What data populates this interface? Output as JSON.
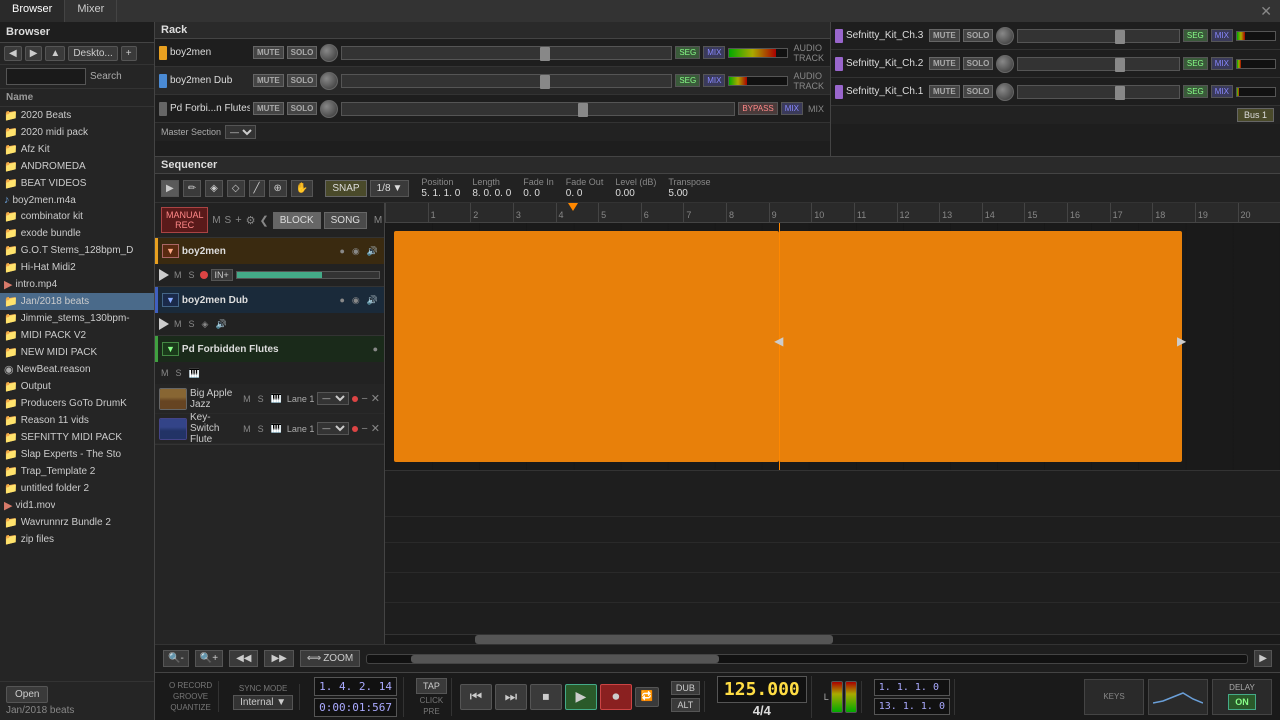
{
  "app": {
    "title": "Browser",
    "mixer_title": "Mixer",
    "rack_title": "Rack",
    "sequencer_title": "Sequencer"
  },
  "browser": {
    "search_placeholder": "",
    "search_label": "Search",
    "name_header": "Name",
    "open_btn": "Open",
    "current_folder": "Jan/2018 beats",
    "files": [
      {
        "name": "2020 Beats",
        "type": "folder"
      },
      {
        "name": "2020 midi pack",
        "type": "folder"
      },
      {
        "name": "Afz Kit",
        "type": "folder"
      },
      {
        "name": "ANDROMEDA",
        "type": "folder"
      },
      {
        "name": "BEAT VIDEOS",
        "type": "folder"
      },
      {
        "name": "boy2men.m4a",
        "type": "audio"
      },
      {
        "name": "combinator kit",
        "type": "folder"
      },
      {
        "name": "exode bundle",
        "type": "folder"
      },
      {
        "name": "G.O.T Stems_128bpm_D",
        "type": "folder"
      },
      {
        "name": "Hi-Hat Midi2",
        "type": "folder"
      },
      {
        "name": "intro.mp4",
        "type": "video"
      },
      {
        "name": "Jan/2018 beats",
        "type": "folder",
        "selected": true
      },
      {
        "name": "Jimmie_stems_130bpm-",
        "type": "folder"
      },
      {
        "name": "MIDI PACK V2",
        "type": "folder"
      },
      {
        "name": "NEW MIDI PACK",
        "type": "folder"
      },
      {
        "name": "NewBeat.reason",
        "type": "file"
      },
      {
        "name": "Output",
        "type": "folder"
      },
      {
        "name": "Producers GoTo DrumK",
        "type": "folder"
      },
      {
        "name": "Reason 11 vids",
        "type": "folder"
      },
      {
        "name": "SEFNITTY MIDI PACK",
        "type": "folder"
      },
      {
        "name": "Slap Experts - The Sto",
        "type": "folder"
      },
      {
        "name": "Trap_Template 2",
        "type": "folder"
      },
      {
        "name": "untitled folder 2",
        "type": "folder"
      },
      {
        "name": "vid1.mov",
        "type": "video"
      },
      {
        "name": "Wavrunnrz Bundle  2",
        "type": "folder"
      },
      {
        "name": "zip files",
        "type": "folder"
      }
    ]
  },
  "mixer": {
    "tracks": [
      {
        "name": "boy2men",
        "type": "audio",
        "color": "orange"
      },
      {
        "name": "boy2men Dub",
        "type": "audio",
        "color": "blue"
      },
      {
        "name": "Pd Forbi...n Flutes",
        "type": "mix",
        "color": "grey"
      }
    ],
    "master_label": "Master Section",
    "right_tracks": [
      {
        "name": "Sefnitty_Kit_Ch.3",
        "color": "purple"
      },
      {
        "name": "Sefnitty_Kit_Ch.2",
        "color": "purple"
      },
      {
        "name": "Sefnitty_Kit_Ch.1",
        "color": "purple"
      }
    ],
    "bus_label": "Bus 1"
  },
  "sequencer": {
    "toolbar": {
      "snap_label": "SNAP",
      "quantize_label": "1/8"
    },
    "position": {
      "label": "Position",
      "value": "5.  1.  1.   0"
    },
    "length": {
      "label": "Length",
      "value": "8.  0.  0.   0"
    },
    "fade_in": {
      "label": "Fade In",
      "value": "0.   0"
    },
    "fade_out": {
      "label": "Fade Out",
      "value": "0.   0"
    },
    "level_db": {
      "label": "Level (dB)",
      "value": "0.00"
    },
    "transpose": {
      "label": "Transpose",
      "value": "5.00"
    },
    "tracks": [
      {
        "name": "boy2men",
        "type": "audio",
        "color": "orange"
      },
      {
        "name": "boy2men Dub",
        "type": "audio",
        "color": "blue"
      },
      {
        "name": "Pd Forbidden Flutes",
        "type": "instrument",
        "color": "green",
        "lanes": [
          {
            "name": "Big Apple Jazz",
            "lane_name": "Lane 1"
          },
          {
            "name": "Key-Switch Flute",
            "lane_name": "Lane 1"
          }
        ]
      }
    ],
    "ruler_marks": [
      "",
      "1",
      "2",
      "3",
      "4",
      "5",
      "6",
      "7",
      "8",
      "9",
      "10",
      "11",
      "12",
      "13",
      "14",
      "15",
      "16",
      "17",
      "18",
      "19",
      "20"
    ],
    "block_btn": "BLOCK",
    "song_btn": "SONG"
  },
  "transport": {
    "record_label": "O RECORD",
    "groove_label": "GROOVE",
    "quantize_label": "QUANTIZE",
    "sync_label": "SYNC MODE",
    "sync_value": "Internal",
    "position_bars": "1. 4. 2. 14",
    "position_time": "0:00:01:567",
    "tap_label": "TAP",
    "click_label": "CLICK",
    "pre_label": "PRE",
    "bpm": "125.000",
    "time_sig": "4/4",
    "dub_label": "DUB",
    "alt_label": "ALT",
    "level_l": "L",
    "level_r": "",
    "right_pos": "1.  1.  1.   0",
    "right_pos2": "13.  1.  1.   0",
    "delay_label": "DELAY",
    "on_label": "ON"
  }
}
